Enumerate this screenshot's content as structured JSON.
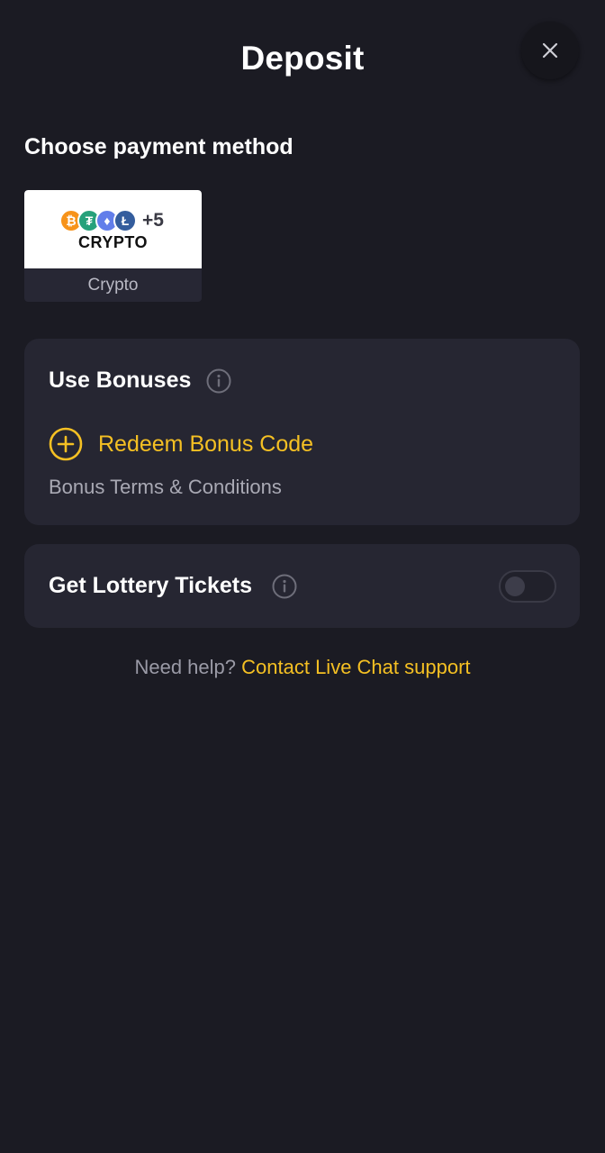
{
  "header": {
    "title": "Deposit",
    "close_icon": "close-icon"
  },
  "payment": {
    "heading": "Choose payment method",
    "methods": [
      {
        "label": "Crypto",
        "logo_text": "CRYPTO",
        "logo_extra_count": "+5",
        "coins": [
          {
            "name": "bitcoin-icon",
            "glyph": "₿",
            "color": "#f7931a"
          },
          {
            "name": "tether-icon",
            "glyph": "₮",
            "color": "#26a17b"
          },
          {
            "name": "ethereum-icon",
            "glyph": "♦",
            "color": "#627eea"
          },
          {
            "name": "litecoin-icon",
            "glyph": "Ł",
            "color": "#345d9d"
          }
        ]
      }
    ]
  },
  "bonuses": {
    "title": "Use Bonuses",
    "info_icon": "info-icon",
    "redeem_label": "Redeem Bonus Code",
    "redeem_icon": "plus-circle-icon",
    "terms_label": "Bonus Terms & Conditions"
  },
  "lottery": {
    "title": "Get Lottery Tickets",
    "info_icon": "info-icon",
    "toggle_on": false
  },
  "help": {
    "text": "Need help?",
    "link": "Contact Live Chat support"
  },
  "colors": {
    "background": "#1b1b23",
    "card": "#262632",
    "accent": "#f5c023",
    "muted_text": "#a9a9b4"
  }
}
